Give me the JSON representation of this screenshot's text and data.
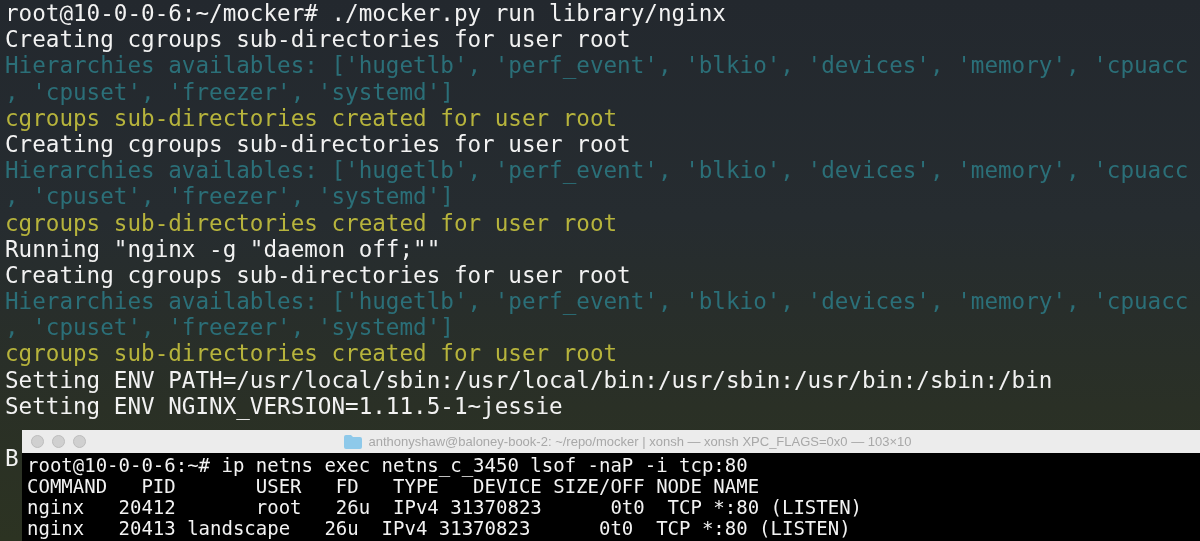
{
  "terminal": {
    "lines": [
      {
        "kind": "command",
        "text": "root@10-0-0-6:~/mocker# ./mocker.py run library/nginx"
      },
      {
        "kind": "info",
        "text": "Creating cgroups sub-directories for user root"
      },
      {
        "kind": "hierarchy",
        "text": "Hierarchies availables: ['hugetlb', 'perf_event', 'blkio', 'devices', 'memory', 'cpuacc"
      },
      {
        "kind": "hierarchy",
        "text": ", 'cpuset', 'freezer', 'systemd']"
      },
      {
        "kind": "created",
        "text": "cgroups sub-directories created for user root"
      },
      {
        "kind": "info",
        "text": "Creating cgroups sub-directories for user root"
      },
      {
        "kind": "hierarchy",
        "text": "Hierarchies availables: ['hugetlb', 'perf_event', 'blkio', 'devices', 'memory', 'cpuacc"
      },
      {
        "kind": "hierarchy",
        "text": ", 'cpuset', 'freezer', 'systemd']"
      },
      {
        "kind": "created",
        "text": "cgroups sub-directories created for user root"
      },
      {
        "kind": "info",
        "text": "Running \"nginx -g \"daemon off;\"\""
      },
      {
        "kind": "info",
        "text": "Creating cgroups sub-directories for user root"
      },
      {
        "kind": "hierarchy",
        "text": "Hierarchies availables: ['hugetlb', 'perf_event', 'blkio', 'devices', 'memory', 'cpuacc"
      },
      {
        "kind": "hierarchy",
        "text": ", 'cpuset', 'freezer', 'systemd']"
      },
      {
        "kind": "created",
        "text": "cgroups sub-directories created for user root"
      },
      {
        "kind": "info",
        "text": "Setting ENV PATH=/usr/local/sbin:/usr/local/bin:/usr/sbin:/usr/bin:/sbin:/bin"
      },
      {
        "kind": "info",
        "text": "Setting ENV NGINX_VERSION=1.11.5-1~jessie"
      },
      {
        "kind": "blank"
      },
      {
        "kind": "info",
        "text": "B"
      }
    ]
  },
  "front_window": {
    "title": "anthonyshaw@baloney-book-2: ~/repo/mocker | xonsh — xonsh XPC_FLAGS=0x0 — 103×10",
    "lines": [
      "root@10-0-0-6:~# ip netns exec netns_c_3450 lsof -naP -i tcp:80",
      "COMMAND   PID       USER   FD   TYPE   DEVICE SIZE/OFF NODE NAME",
      "nginx   20412       root   26u  IPv4 31370823      0t0  TCP *:80 (LISTEN)",
      "nginx   20413 landscape   26u  IPv4 31370823      0t0  TCP *:80 (LISTEN)"
    ]
  }
}
